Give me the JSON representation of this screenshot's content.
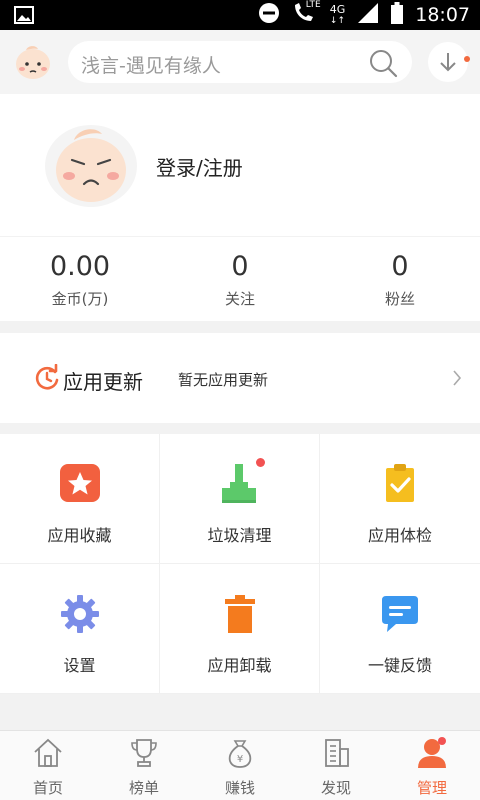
{
  "status_bar": {
    "time": "18:07",
    "network_label": "4G",
    "lte_label": "LTE",
    "icons": [
      "image-icon",
      "dnd-icon",
      "call-lte-icon",
      "signal-icon",
      "battery-icon"
    ]
  },
  "header": {
    "logo_icon": "app-logo-face-icon",
    "search_placeholder": "浅言-遇见有缘人",
    "search_icon": "search-icon",
    "download_icon": "download-icon"
  },
  "profile": {
    "login_label": "登录/注册",
    "avatar_icon": "avatar-face-icon"
  },
  "stats": [
    {
      "value": "0.00",
      "label": "金币(万)"
    },
    {
      "value": "0",
      "label": "关注"
    },
    {
      "value": "0",
      "label": "粉丝"
    }
  ],
  "update": {
    "title": "应用更新",
    "status": "暂无应用更新",
    "icon": "refresh-icon"
  },
  "grid": [
    {
      "label": "应用收藏",
      "icon": "star-icon",
      "color": "#f2603f"
    },
    {
      "label": "垃圾清理",
      "icon": "stamp-clean-icon",
      "color": "#5cc96a"
    },
    {
      "label": "应用体检",
      "icon": "clipboard-check-icon",
      "color": "#f5be1f"
    },
    {
      "label": "设置",
      "icon": "gear-icon",
      "color": "#7b8de8"
    },
    {
      "label": "应用卸载",
      "icon": "trash-icon",
      "color": "#f47b1e"
    },
    {
      "label": "一键反馈",
      "icon": "chat-icon",
      "color": "#3a97ef"
    }
  ],
  "bottom_nav": [
    {
      "label": "首页",
      "icon": "home-icon"
    },
    {
      "label": "榜单",
      "icon": "trophy-icon"
    },
    {
      "label": "赚钱",
      "icon": "money-bag-icon"
    },
    {
      "label": "发现",
      "icon": "building-icon"
    },
    {
      "label": "管理",
      "icon": "user-icon",
      "active": true
    }
  ],
  "colors": {
    "accent": "#f26a3f",
    "notification_dot": "#f25252"
  }
}
